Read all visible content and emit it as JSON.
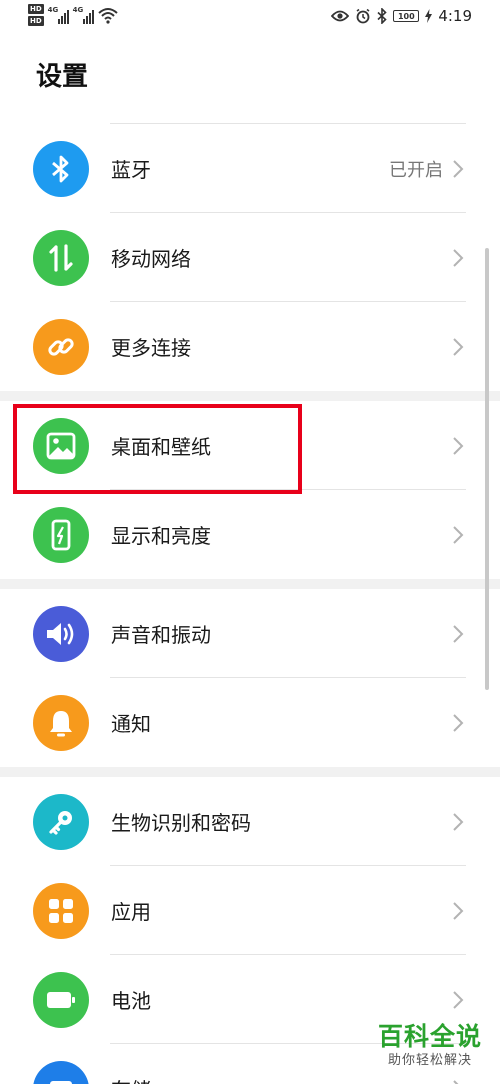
{
  "status_bar": {
    "hd1": "HD",
    "hd2": "HD",
    "sig1": "4G",
    "sig2": "4G",
    "battery": "100",
    "time": "4:19"
  },
  "title": "设置",
  "colors": {
    "bluetooth": "#1e9bf0",
    "green": "#3dc24f",
    "orange": "#f79a1c",
    "violet": "#4a5cd8",
    "teal": "#1cb8c9",
    "highlight": "#e8001a"
  },
  "groups": [
    [
      {
        "name": "bluetooth",
        "label": "蓝牙",
        "value": "已开启",
        "icon": "bluetooth-icon"
      },
      {
        "name": "mobile-network",
        "label": "移动网络",
        "icon": "data-arrows-icon"
      },
      {
        "name": "more-connections",
        "label": "更多连接",
        "icon": "link-icon"
      }
    ],
    [
      {
        "name": "home-wallpaper",
        "label": "桌面和壁纸",
        "icon": "image-icon"
      },
      {
        "name": "display-brightness",
        "label": "显示和亮度",
        "icon": "phone-brightness-icon"
      }
    ],
    [
      {
        "name": "sound-vibration",
        "label": "声音和振动",
        "icon": "speaker-icon"
      },
      {
        "name": "notifications",
        "label": "通知",
        "icon": "bell-icon"
      }
    ],
    [
      {
        "name": "biometrics-password",
        "label": "生物识别和密码",
        "icon": "key-icon"
      },
      {
        "name": "apps",
        "label": "应用",
        "icon": "grid-icon"
      },
      {
        "name": "battery",
        "label": "电池",
        "icon": "battery-icon"
      },
      {
        "name": "storage",
        "label": "存储",
        "icon": "storage-icon"
      }
    ]
  ],
  "watermark": {
    "title": "百科全说",
    "subtitle": "助你轻松解决"
  }
}
